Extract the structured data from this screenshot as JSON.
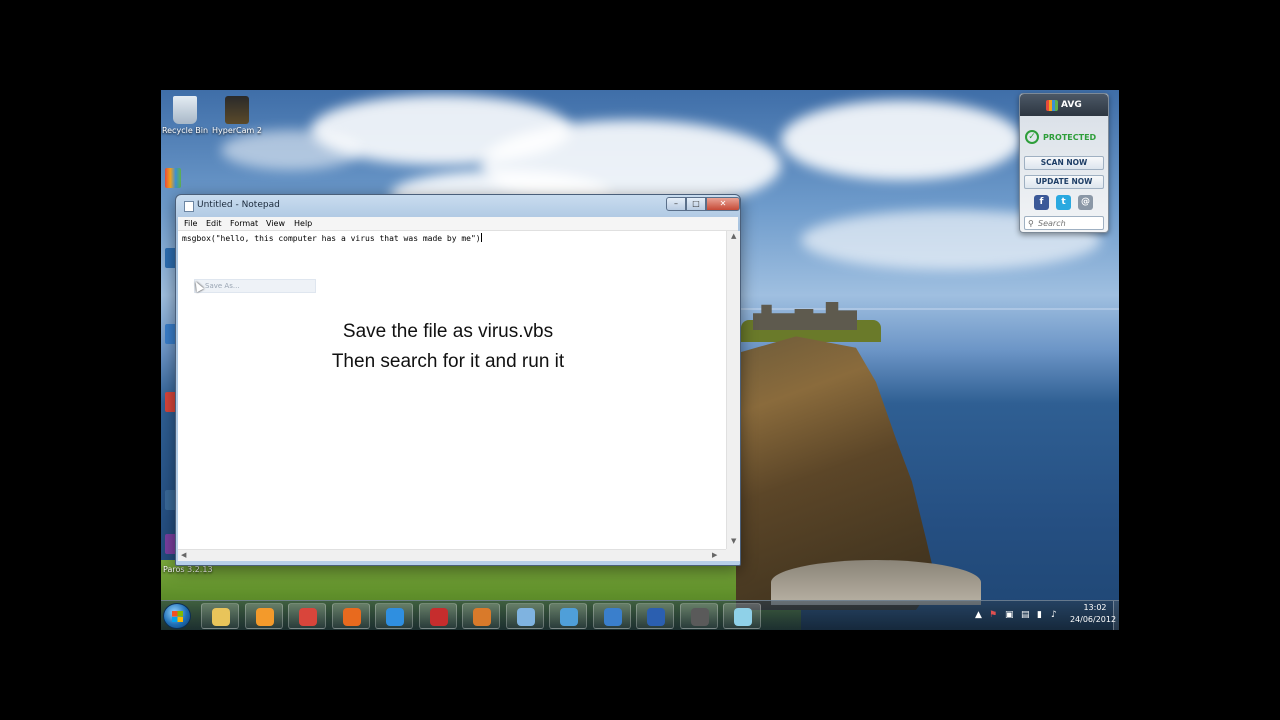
{
  "desktop": {
    "icons": [
      {
        "label": "Recycle Bin"
      },
      {
        "label": "HyperCam 2"
      },
      {
        "label": "Paros 3.2.13"
      }
    ]
  },
  "notepad": {
    "title": "Untitled - Notepad",
    "caption_buttons": {
      "minimize": "–",
      "maximize": "□",
      "close": "✕"
    },
    "menu": [
      "File",
      "Edit",
      "Format",
      "View",
      "Help"
    ],
    "content": "msgbox(\"hello, this computer has a virus that was made by me\")",
    "hover_menu_item": "Save As...",
    "overlay_text": {
      "line1": "Save the file as virus.vbs",
      "line2": "Then search for it and run it"
    }
  },
  "avg_gadget": {
    "brand": "AVG",
    "status": "PROTECTED",
    "scan_button": "SCAN NOW",
    "update_button": "UPDATE NOW",
    "social": {
      "facebook": "f",
      "twitter": "t",
      "web": "@"
    },
    "search_placeholder": "Search"
  },
  "taskbar": {
    "pinned": [
      {
        "name": "windows-explorer",
        "color": "#e8c45a"
      },
      {
        "name": "media-player",
        "color": "#f39a2b"
      },
      {
        "name": "chrome",
        "color": "#d9453b"
      },
      {
        "name": "firefox",
        "color": "#e86a1e"
      },
      {
        "name": "internet-explorer",
        "color": "#2f8fe0"
      },
      {
        "name": "hypercam",
        "color": "#c62d2d"
      },
      {
        "name": "paros",
        "color": "#d97a2a"
      },
      {
        "name": "paint",
        "color": "#7fb3e0"
      },
      {
        "name": "remote-desktop",
        "color": "#4f9fd9"
      },
      {
        "name": "itunes",
        "color": "#3a7fcc"
      },
      {
        "name": "word",
        "color": "#2b5fb0"
      },
      {
        "name": "hypercam-2",
        "color": "#5a5a5a"
      },
      {
        "name": "notepad",
        "color": "#8fd1e8"
      }
    ],
    "clock": {
      "time": "13:02",
      "date": "24/06/2012"
    }
  }
}
